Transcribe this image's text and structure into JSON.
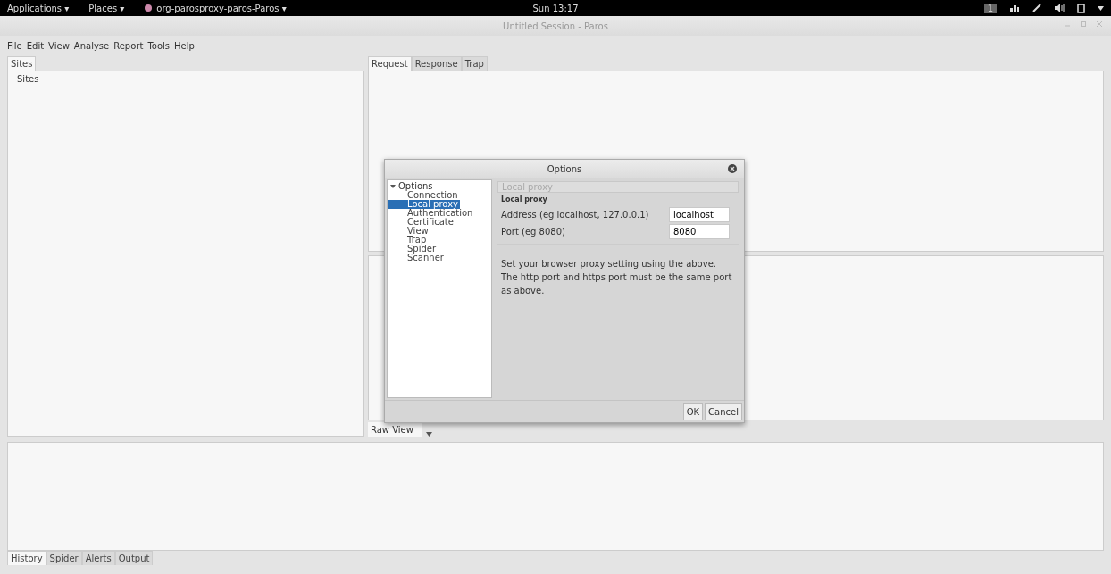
{
  "top_bar": {
    "menus": [
      "Applications ▾",
      "Places ▾",
      "org-parosproxy-paros-Paros ▾"
    ],
    "clock": "Sun 13:17",
    "workspace": "1"
  },
  "window": {
    "title": "Untitled Session - Paros"
  },
  "menu": [
    "File",
    "Edit",
    "View",
    "Analyse",
    "Report",
    "Tools",
    "Help"
  ],
  "sites_tab": {
    "label": "Sites",
    "selected": true
  },
  "sites_tree": [
    "Sites"
  ],
  "message_tabs": [
    {
      "label": "Request",
      "selected": true
    },
    {
      "label": "Response",
      "selected": false
    },
    {
      "label": "Trap",
      "selected": false
    }
  ],
  "view_select": {
    "value": "Raw View"
  },
  "bottom_tabs": [
    {
      "label": "History",
      "selected": true
    },
    {
      "label": "Spider",
      "selected": false
    },
    {
      "label": "Alerts",
      "selected": false
    },
    {
      "label": "Output",
      "selected": false
    }
  ],
  "dialog": {
    "title": "Options",
    "tree": {
      "label": "Options",
      "expanded": true,
      "children": [
        {
          "label": "Connection",
          "selected": false
        },
        {
          "label": "Local proxy",
          "selected": true
        },
        {
          "label": "Authentication",
          "selected": false
        },
        {
          "label": "Certificate",
          "selected": false
        },
        {
          "label": "View",
          "selected": false
        },
        {
          "label": "Trap",
          "selected": false
        },
        {
          "label": "Spider",
          "selected": false
        },
        {
          "label": "Scanner",
          "selected": false
        }
      ]
    },
    "panel_header": "Local proxy",
    "group_title": "Local proxy",
    "fields": [
      {
        "label": "Address (eg localhost, 127.0.0.1)",
        "value": "localhost"
      },
      {
        "label": "Port (eg 8080)",
        "value": "8080"
      }
    ],
    "note": "Set your browser proxy setting using the above. The http port and https port must be the same port as above.",
    "buttons": [
      "OK",
      "Cancel"
    ]
  }
}
